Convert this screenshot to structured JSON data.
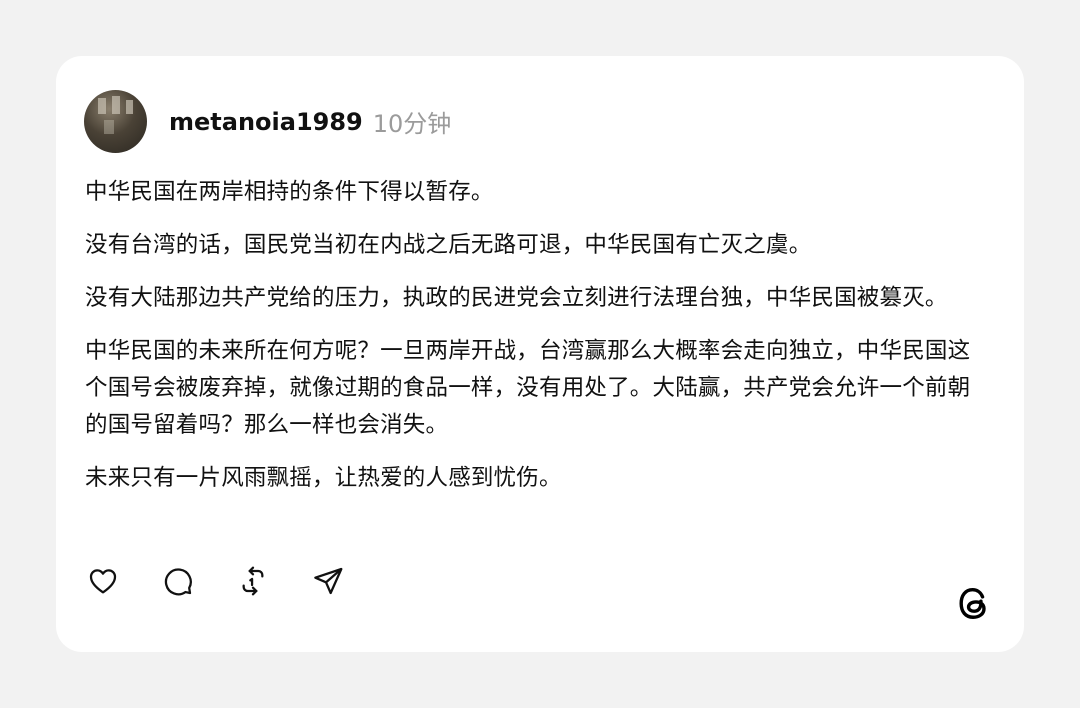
{
  "post": {
    "username": "metanoia1989",
    "time": "10分钟",
    "paragraphs": [
      "中华民国在两岸相持的条件下得以暂存。",
      "没有台湾的话，国民党当初在内战之后无路可退，中华民国有亡灭之虞。",
      "没有大陆那边共产党给的压力，执政的民进党会立刻进行法理台独，中华民国被篡灭。",
      "中华民国的未来所在何方呢？一旦两岸开战，台湾赢那么大概率会走向独立，中华民国这个国号会被废弃掉，就像过期的食品一样，没有用处了。大陆赢，共产党会允许一个前朝的国号留着吗？那么一样也会消失。",
      "未来只有一片风雨飘摇，让热爱的人感到忧伤。"
    ]
  },
  "actions": {
    "like_icon": "heart-icon",
    "comment_icon": "comment-icon",
    "repost_icon": "repost-icon",
    "share_icon": "send-icon"
  },
  "brand": {
    "logo_icon": "threads-logo-icon"
  },
  "colors": {
    "background": "#f2f2f2",
    "card": "#ffffff",
    "text": "#111111",
    "muted": "#9b9b9b"
  }
}
